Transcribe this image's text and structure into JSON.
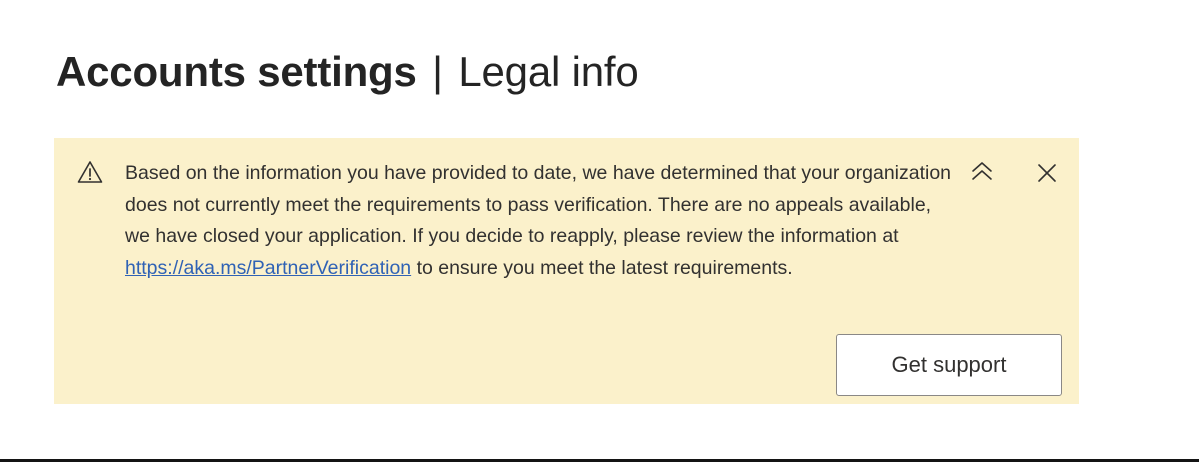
{
  "header": {
    "title_main": "Accounts settings",
    "separator": "|",
    "title_sub": "Legal info"
  },
  "warning": {
    "icon": "warning-triangle-icon",
    "message_before_link": "Based on the information you have provided to date, we have determined that your organization does not currently meet the requirements to pass verification. There are no appeals available, we have closed your application. If you decide to reapply, please review the information at",
    "link_text": "https://aka.ms/PartnerVerification",
    "message_after_link": "to ensure you meet the latest requirements.",
    "collapse_icon": "chevron-double-up-icon",
    "close_icon": "close-icon",
    "action_label": "Get support",
    "background_color": "#fbf1cb",
    "link_color": "#2f62b5"
  }
}
